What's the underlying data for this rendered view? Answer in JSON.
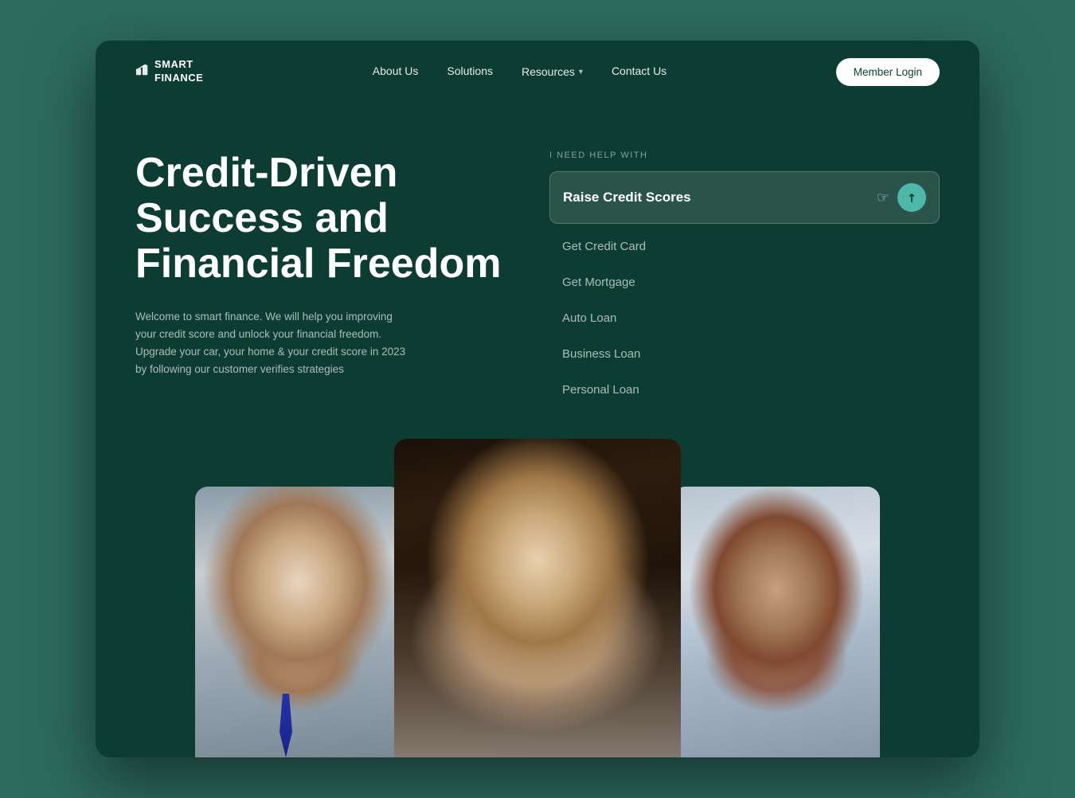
{
  "site": {
    "logo_line1": "SMART",
    "logo_line2": "FINANCE",
    "logo_symbol": "▶"
  },
  "navbar": {
    "links": [
      {
        "label": "About Us",
        "has_dropdown": false
      },
      {
        "label": "Solutions",
        "has_dropdown": false
      },
      {
        "label": "Resources",
        "has_dropdown": true
      },
      {
        "label": "Contact Us",
        "has_dropdown": false
      }
    ],
    "cta_label": "Member Login"
  },
  "hero": {
    "title": "Credit-Driven Success and Financial Freedom",
    "description": "Welcome to smart finance. We will help you improving your credit score and unlock your financial freedom. Upgrade your car, your home & your credit score in 2023 by following our customer verifies strategies"
  },
  "help_widget": {
    "label": "I NEED HELP WITH",
    "selected": "Raise Credit Scores",
    "options": [
      "Get Credit Card",
      "Get Mortgage",
      "Auto Loan",
      "Business Loan",
      "Personal Loan"
    ]
  }
}
